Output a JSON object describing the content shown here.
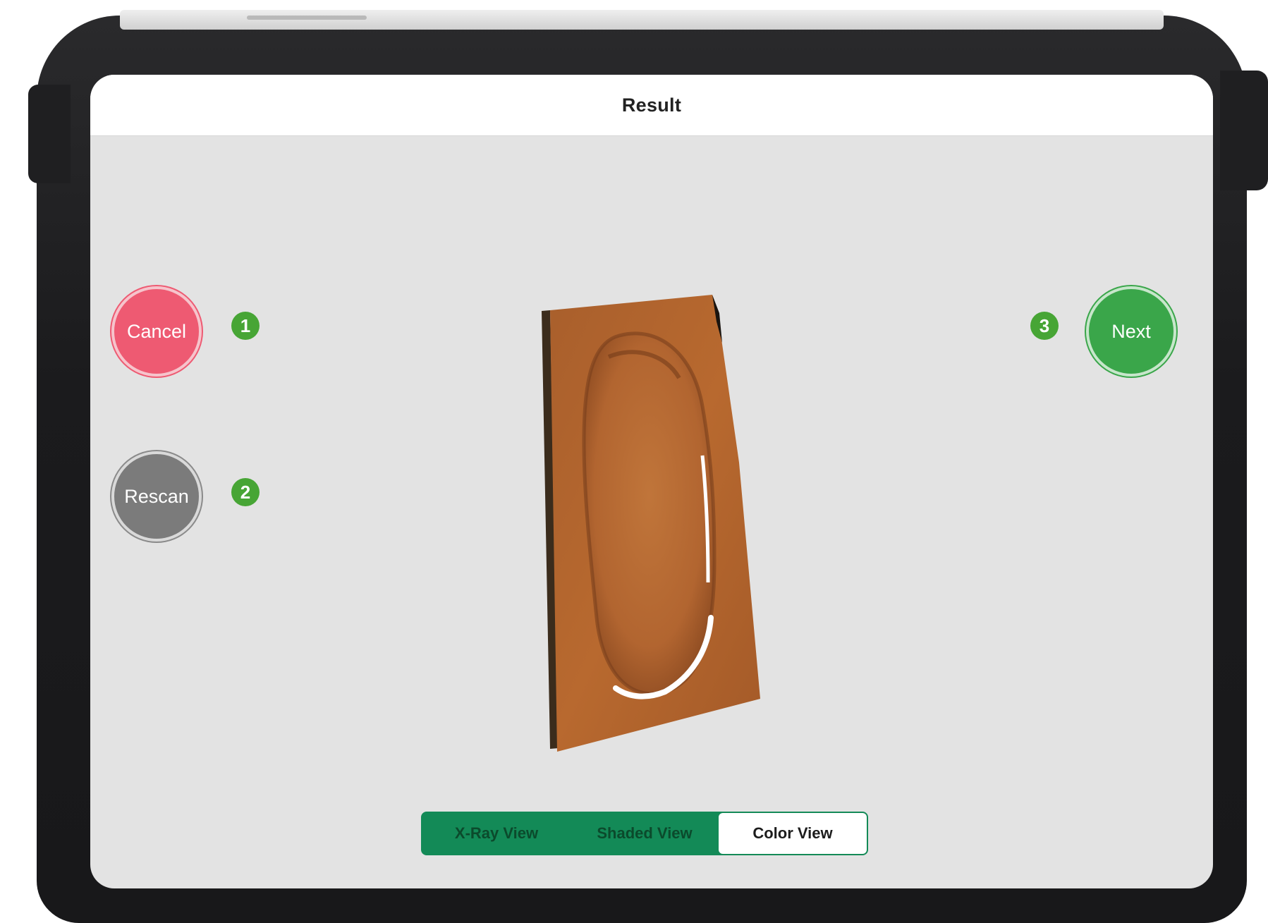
{
  "header": {
    "title": "Result"
  },
  "actions": {
    "cancel_label": "Cancel",
    "rescan_label": "Rescan",
    "next_label": "Next"
  },
  "badges": {
    "cancel": "1",
    "rescan": "2",
    "next": "3"
  },
  "view_modes": {
    "options": [
      "X-Ray View",
      "Shaded View",
      "Color View"
    ],
    "selected": "Color View"
  },
  "colors": {
    "cancel": "#ee5a72",
    "rescan": "#7b7b7b",
    "next": "#3aa64a",
    "badge": "#47a535",
    "segmented_bg": "#138a57"
  },
  "preview": {
    "subject": "foot-impression-scan"
  }
}
